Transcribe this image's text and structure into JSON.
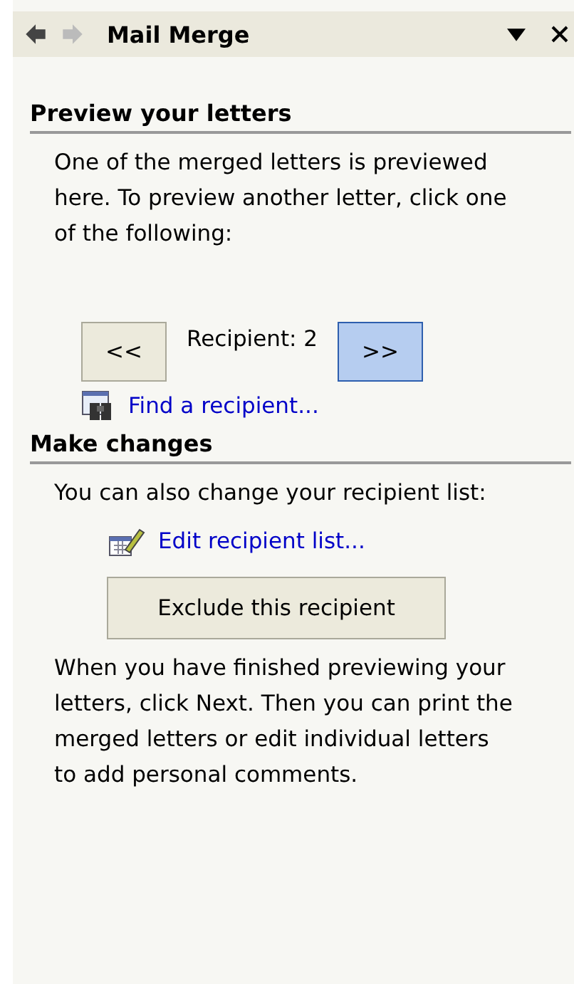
{
  "title_bar": {
    "title": "Mail Merge",
    "back": {
      "disabled": false
    },
    "forward": {
      "disabled": true
    }
  },
  "sections": [
    {
      "heading": "Preview your letters",
      "items": [
        {
          "kind": "text",
          "text": "One of the merged letters is previewed here. To preview another letter, click one of the following:"
        },
        {
          "kind": "navigator",
          "prev": {
            "label": "<<",
            "hot": false
          },
          "reading": "Recipient: 2",
          "next": {
            "label": ">>",
            "hot": true
          }
        },
        {
          "kind": "find_link",
          "label": "Find a recipient..."
        }
      ]
    },
    {
      "heading": "Make changes",
      "items": [
        {
          "kind": "text",
          "text": "You can also change your recipient list:"
        },
        {
          "kind": "edit_link",
          "label": "Edit recipient list..."
        },
        {
          "kind": "button",
          "label": "Exclude this recipient"
        },
        {
          "kind": "text",
          "text": "When you have finished previewing your letters, click Next. Then you can print the merged letters or edit individual letters to add personal comments."
        }
      ]
    }
  ]
}
